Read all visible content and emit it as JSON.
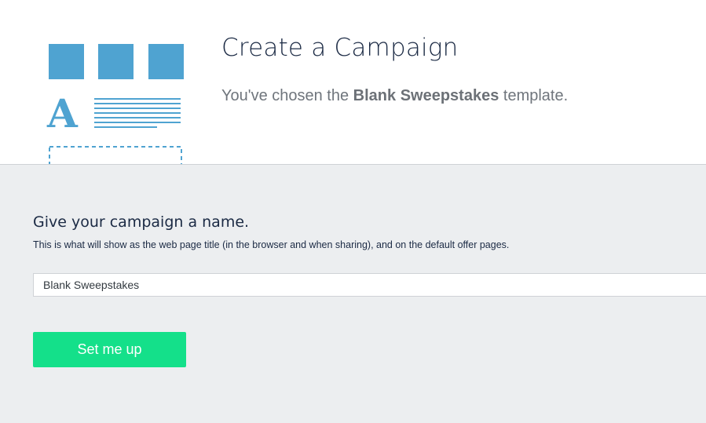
{
  "header": {
    "title": "Create a Campaign",
    "subtitle_prefix": "You've chosen the",
    "template_name": "Blank Sweepstakes",
    "subtitle_suffix": "template."
  },
  "illustration": {
    "icon": "blank-template-illustration",
    "letter": "A",
    "color": "#4fa3d1"
  },
  "form": {
    "name_heading": "Give your campaign a name.",
    "name_help": "This is what will show as the web page title (in the browser and when sharing), and on the default offer pages.",
    "name_value": "Blank Sweepstakes",
    "submit_label": "Set me up"
  },
  "colors": {
    "accent_green": "#14e08a",
    "heading_navy": "#1b2a44",
    "panel_gray": "#eceef0"
  }
}
